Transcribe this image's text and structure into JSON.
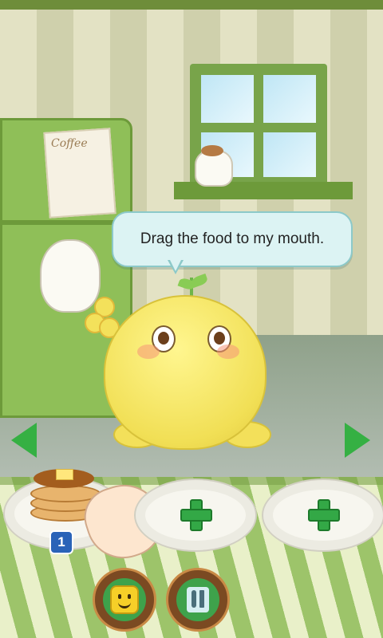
{
  "speech_bubble": {
    "text": "Drag the food to my mouth."
  },
  "fridge_card": {
    "text": "Coffee"
  },
  "food_tray": {
    "selected_item_count": "1",
    "empty_slot_icons": [
      "add-food-icon",
      "add-food-icon"
    ]
  },
  "menu": {
    "buttons": [
      "emotion-icon",
      "food-utensils-icon"
    ]
  },
  "colors": {
    "accent": "#35b043",
    "badge": "#2a63b8",
    "pet": "#f1df55"
  }
}
